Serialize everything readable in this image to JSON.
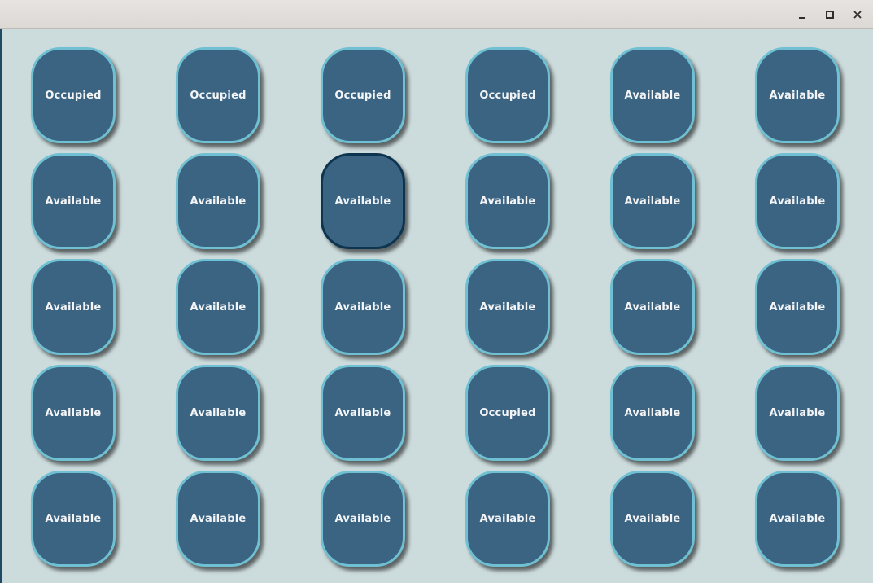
{
  "window": {
    "controls": [
      "minimize-icon",
      "maximize-icon",
      "close-icon"
    ]
  },
  "seats": [
    {
      "status": "Occupied"
    },
    {
      "status": "Occupied"
    },
    {
      "status": "Occupied"
    },
    {
      "status": "Occupied"
    },
    {
      "status": "Available"
    },
    {
      "status": "Available"
    },
    {
      "status": "Available"
    },
    {
      "status": "Available"
    },
    {
      "status": "Available",
      "focused": true
    },
    {
      "status": "Available"
    },
    {
      "status": "Available"
    },
    {
      "status": "Available"
    },
    {
      "status": "Available"
    },
    {
      "status": "Available"
    },
    {
      "status": "Available"
    },
    {
      "status": "Available"
    },
    {
      "status": "Available"
    },
    {
      "status": "Available"
    },
    {
      "status": "Available"
    },
    {
      "status": "Available"
    },
    {
      "status": "Available"
    },
    {
      "status": "Occupied"
    },
    {
      "status": "Available"
    },
    {
      "status": "Available"
    },
    {
      "status": "Available"
    },
    {
      "status": "Available"
    },
    {
      "status": "Available"
    },
    {
      "status": "Available"
    },
    {
      "status": "Available"
    },
    {
      "status": "Available"
    }
  ],
  "colors": {
    "background": "#ccdbdc",
    "seat_fill": "#3b6382",
    "seat_border": "#6fc0d2",
    "seat_focus_border": "#0e3550",
    "seat_text": "#f2f4f6"
  }
}
